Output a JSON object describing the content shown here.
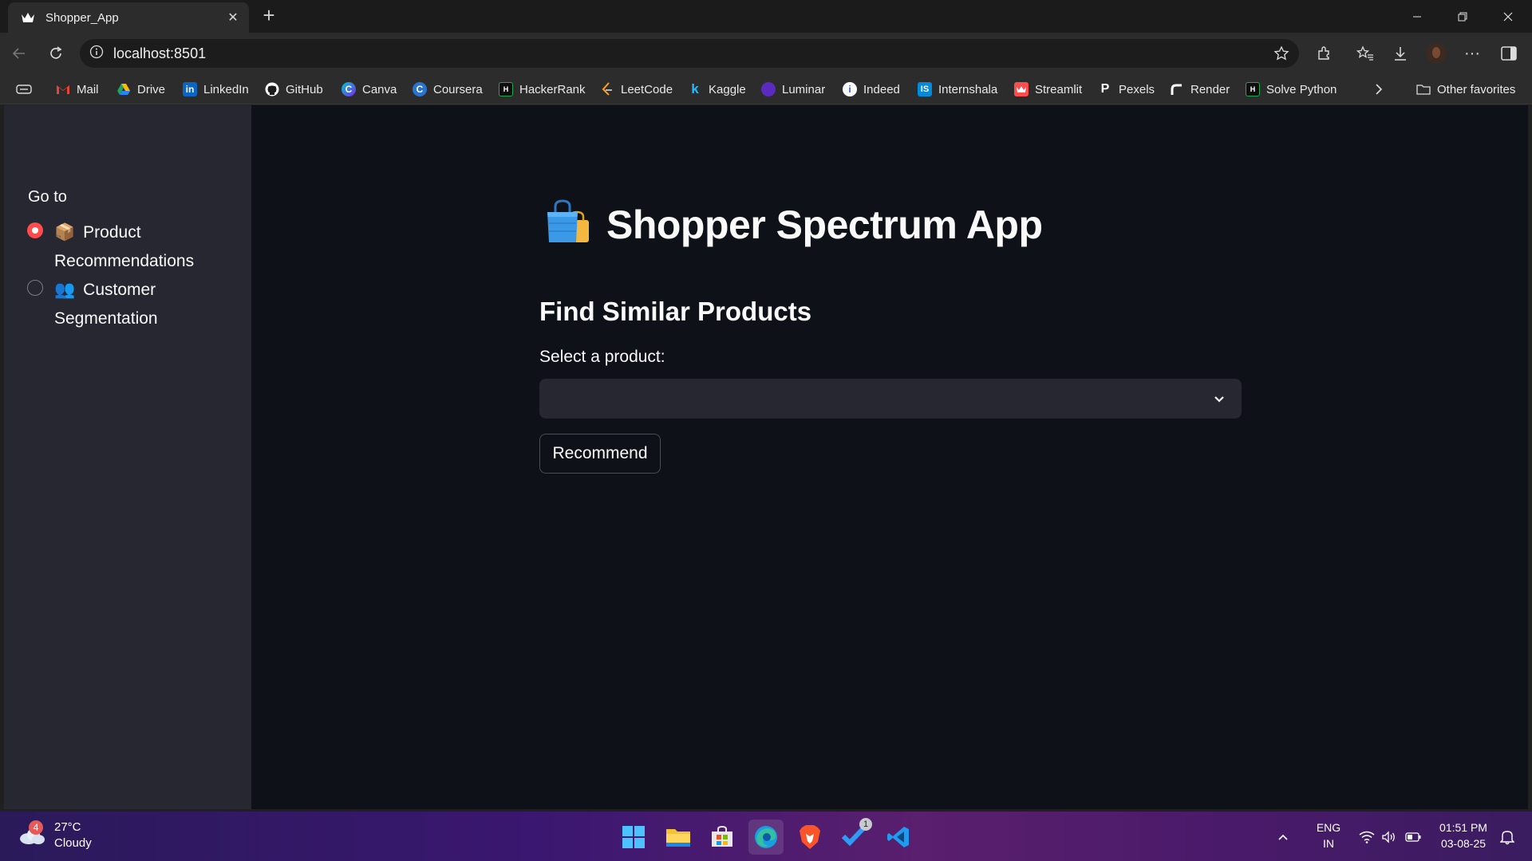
{
  "browser": {
    "tab_title": "Shopper_App",
    "url": "localhost:8501",
    "bookmarks": [
      {
        "label": "Mail",
        "icon": "gmail-icon",
        "color": "#ea4335"
      },
      {
        "label": "Drive",
        "icon": "drive-icon",
        "color": "#1fa463"
      },
      {
        "label": "LinkedIn",
        "icon": "linkedin-icon",
        "color": "#0a66c2"
      },
      {
        "label": "GitHub",
        "icon": "github-icon",
        "color": "#ffffff"
      },
      {
        "label": "Canva",
        "icon": "canva-icon",
        "color": "#00c4cc"
      },
      {
        "label": "Coursera",
        "icon": "coursera-icon",
        "color": "#2a73cc"
      },
      {
        "label": "HackerRank",
        "icon": "hackerrank-icon",
        "color": "#1ba94c"
      },
      {
        "label": "LeetCode",
        "icon": "leetcode-icon",
        "color": "#ffa116"
      },
      {
        "label": "Kaggle",
        "icon": "kaggle-icon",
        "color": "#20beff"
      },
      {
        "label": "Luminar",
        "icon": "luminar-icon",
        "color": "#8a3ffc"
      },
      {
        "label": "Indeed",
        "icon": "indeed-icon",
        "color": "#2164f3"
      },
      {
        "label": "Internshala",
        "icon": "internshala-icon",
        "color": "#008bdc"
      },
      {
        "label": "Streamlit",
        "icon": "streamlit-icon",
        "color": "#ff4b4b"
      },
      {
        "label": "Pexels",
        "icon": "pexels-icon",
        "color": "#ffffff"
      },
      {
        "label": "Render",
        "icon": "render-icon",
        "color": "#ffffff"
      },
      {
        "label": "Solve Python",
        "icon": "hackerrank-icon",
        "color": "#1ba94c"
      }
    ],
    "other_favorites": "Other favorites"
  },
  "sidebar": {
    "heading": "Go to",
    "options": [
      {
        "emoji": "📦",
        "label": "Product Recommendations",
        "selected": true
      },
      {
        "emoji": "👥",
        "label": "Customer Segmentation",
        "selected": false
      }
    ]
  },
  "main": {
    "title_emoji": "🛍️",
    "title": "Shopper Spectrum App",
    "subheader": "Find Similar Products",
    "select_label": "Select a product:",
    "select_value": "",
    "button_label": "Recommend"
  },
  "taskbar": {
    "weather_temp": "27°C",
    "weather_desc": "Cloudy",
    "weather_badge": "4",
    "lang_line1": "ENG",
    "lang_line2": "IN",
    "time": "01:51 PM",
    "date": "03-08-25",
    "todo_badge": "1"
  },
  "colors": {
    "accent": "#ff4b4b",
    "app_bg": "#0e1117",
    "sidebar_bg": "#262730"
  }
}
